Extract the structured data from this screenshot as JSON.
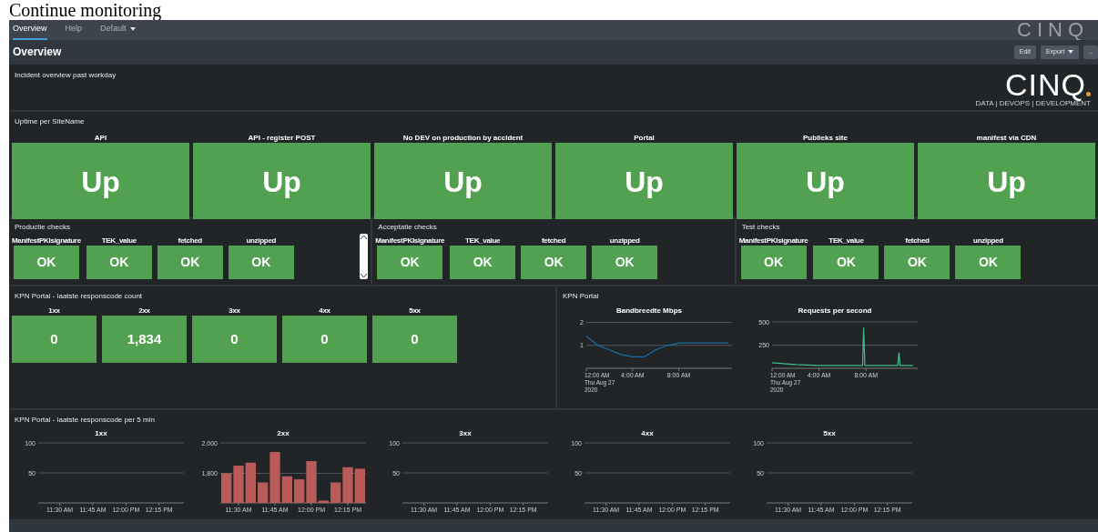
{
  "page_caption": "Continue monitoring",
  "nav": {
    "tabs": [
      {
        "label": "Overview",
        "selected": true,
        "kind": "link"
      },
      {
        "label": "Help",
        "selected": false,
        "kind": "link"
      },
      {
        "label": "Default",
        "selected": false,
        "kind": "menu"
      }
    ],
    "faded_logo": "CINQ"
  },
  "dashboard": {
    "title": "Overview",
    "buttons": [
      {
        "label": "Edit",
        "kind": "plain"
      },
      {
        "label": "Export",
        "kind": "menu"
      },
      {
        "label": "..",
        "kind": "plain"
      }
    ]
  },
  "incident_panel": {
    "text": "Incident overview past workday",
    "logo": {
      "name": "CINQ",
      "tagline": "DATA | DEVOPS | DEVELOPMENT"
    }
  },
  "uptime_panel": {
    "title": "Uptime per SiteName",
    "tiles": [
      {
        "label": "API",
        "value": "Up"
      },
      {
        "label": "API - register POST",
        "value": "Up"
      },
      {
        "label": "No DEV on production by accident",
        "value": "Up"
      },
      {
        "label": "Portal",
        "value": "Up"
      },
      {
        "label": "Publieks site",
        "value": "Up"
      },
      {
        "label": "manifest via CDN",
        "value": "Up"
      }
    ]
  },
  "check_panels": [
    {
      "title": "Productie checks",
      "scrollbar": true,
      "tiles": [
        {
          "label": "ManifestPKIsignature",
          "value": "OK"
        },
        {
          "label": "TEK_value",
          "value": "OK"
        },
        {
          "label": "fetched",
          "value": "OK"
        },
        {
          "label": "unzipped",
          "value": "OK"
        }
      ]
    },
    {
      "title": "Acceptatie checks",
      "scrollbar": false,
      "tiles": [
        {
          "label": "ManifestPKIsignature",
          "value": "OK"
        },
        {
          "label": "TEK_value",
          "value": "OK"
        },
        {
          "label": "fetched",
          "value": "OK"
        },
        {
          "label": "unzipped",
          "value": "OK"
        }
      ]
    },
    {
      "title": "Test checks",
      "scrollbar": false,
      "tiles": [
        {
          "label": "ManifestPKIsignature",
          "value": "OK"
        },
        {
          "label": "TEK_value",
          "value": "OK"
        },
        {
          "label": "fetched",
          "value": "OK"
        },
        {
          "label": "unzipped",
          "value": "OK"
        }
      ]
    }
  ],
  "count_panel": {
    "title": "KPN Portal - laatste responscode count",
    "tiles": [
      {
        "label": "1xx",
        "value": "0"
      },
      {
        "label": "2xx",
        "value": "1,834"
      },
      {
        "label": "3xx",
        "value": "0"
      },
      {
        "label": "4xx",
        "value": "0"
      },
      {
        "label": "5xx",
        "value": "0"
      }
    ]
  },
  "line_panel": {
    "title": "KPN Portal",
    "charts": [
      {
        "chart_data": {
          "type": "line",
          "title": "Bandbreedte Mbps",
          "x": [
            0,
            0.5,
            1,
            2,
            3,
            4,
            5,
            6,
            7,
            8,
            9,
            10,
            11,
            12.3
          ],
          "series": [
            {
              "color": "#1a6ea3",
              "values": [
                1.4,
                1.2,
                1.0,
                0.8,
                0.6,
                0.5,
                0.5,
                0.8,
                1.0,
                1.1,
                1.1,
                1.1,
                1.1,
                1.1
              ]
            }
          ],
          "xlim": [
            0,
            12.6
          ],
          "ylim": [
            0,
            2.1
          ],
          "yticks": [
            1,
            2
          ],
          "xticks": [
            {
              "value": 0,
              "label": "12:00 AM\nThu Aug 27\n2020"
            },
            {
              "value": 4,
              "label": "4:00 AM"
            },
            {
              "value": 8,
              "label": "8:00 AM"
            }
          ]
        }
      },
      {
        "chart_data": {
          "type": "line",
          "title": "Requests per second",
          "x": [
            0,
            2,
            4,
            6,
            7.7,
            7.8,
            7.9,
            10,
            10.7,
            10.8,
            10.9,
            12
          ],
          "series": [
            {
              "color": "#3fbf8c",
              "values": [
                60,
                40,
                30,
                30,
                30,
                440,
                30,
                30,
                30,
                170,
                30,
                30
              ]
            }
          ],
          "xlim": [
            0,
            12.4
          ],
          "ylim": [
            0,
            520
          ],
          "yticks": [
            250,
            500
          ],
          "xticks": [
            {
              "value": 0,
              "label": "12:00 AM\nThu Aug 27\n2020"
            },
            {
              "value": 4,
              "label": "4:00 AM"
            },
            {
              "value": 8,
              "label": "8:00 AM"
            }
          ]
        }
      }
    ]
  },
  "bar_panel": {
    "title": "KPN Portal - laatste responscode per 5 min",
    "charts": [
      {
        "kind": "empty",
        "title": "1xx",
        "y_labels": [
          "100",
          "50"
        ],
        "x_labels": [
          "11:30 AM",
          "11:45 AM",
          "12:00 PM",
          "12:15 PM"
        ]
      },
      {
        "kind": "chart",
        "chart_data": {
          "type": "bar",
          "title": "2xx",
          "categories": [
            null,
            "11:30 AM",
            null,
            null,
            "11:45 AM",
            null,
            null,
            "12:00 PM",
            null,
            null,
            "12:15 PM",
            null
          ],
          "series": [
            {
              "color": "#b85b59",
              "values": [
                1800,
                1850,
                1870,
                1740,
                1940,
                1780,
                1760,
                1880,
                1620,
                1740,
                1840,
                1830
              ]
            }
          ],
          "ylim": [
            1605,
            2000
          ],
          "yticks": [
            {
              "value": 1800,
              "label": "1,800"
            },
            {
              "value": 2000,
              "label": "2,000"
            }
          ]
        }
      },
      {
        "kind": "empty",
        "title": "3xx",
        "y_labels": [
          "100",
          "50"
        ],
        "x_labels": [
          "11:30 AM",
          "11:45 AM",
          "12:00 PM",
          "12:15 PM"
        ]
      },
      {
        "kind": "empty",
        "title": "4xx",
        "y_labels": [
          "100",
          "50"
        ],
        "x_labels": [
          "11:30 AM",
          "11:45 AM",
          "12:00 PM",
          "12:15 PM"
        ]
      },
      {
        "kind": "empty",
        "title": "5xx",
        "y_labels": [
          "100",
          "50"
        ],
        "x_labels": [
          "11:30 AM",
          "11:45 AM",
          "12:00 PM",
          "12:15 PM"
        ]
      }
    ]
  }
}
